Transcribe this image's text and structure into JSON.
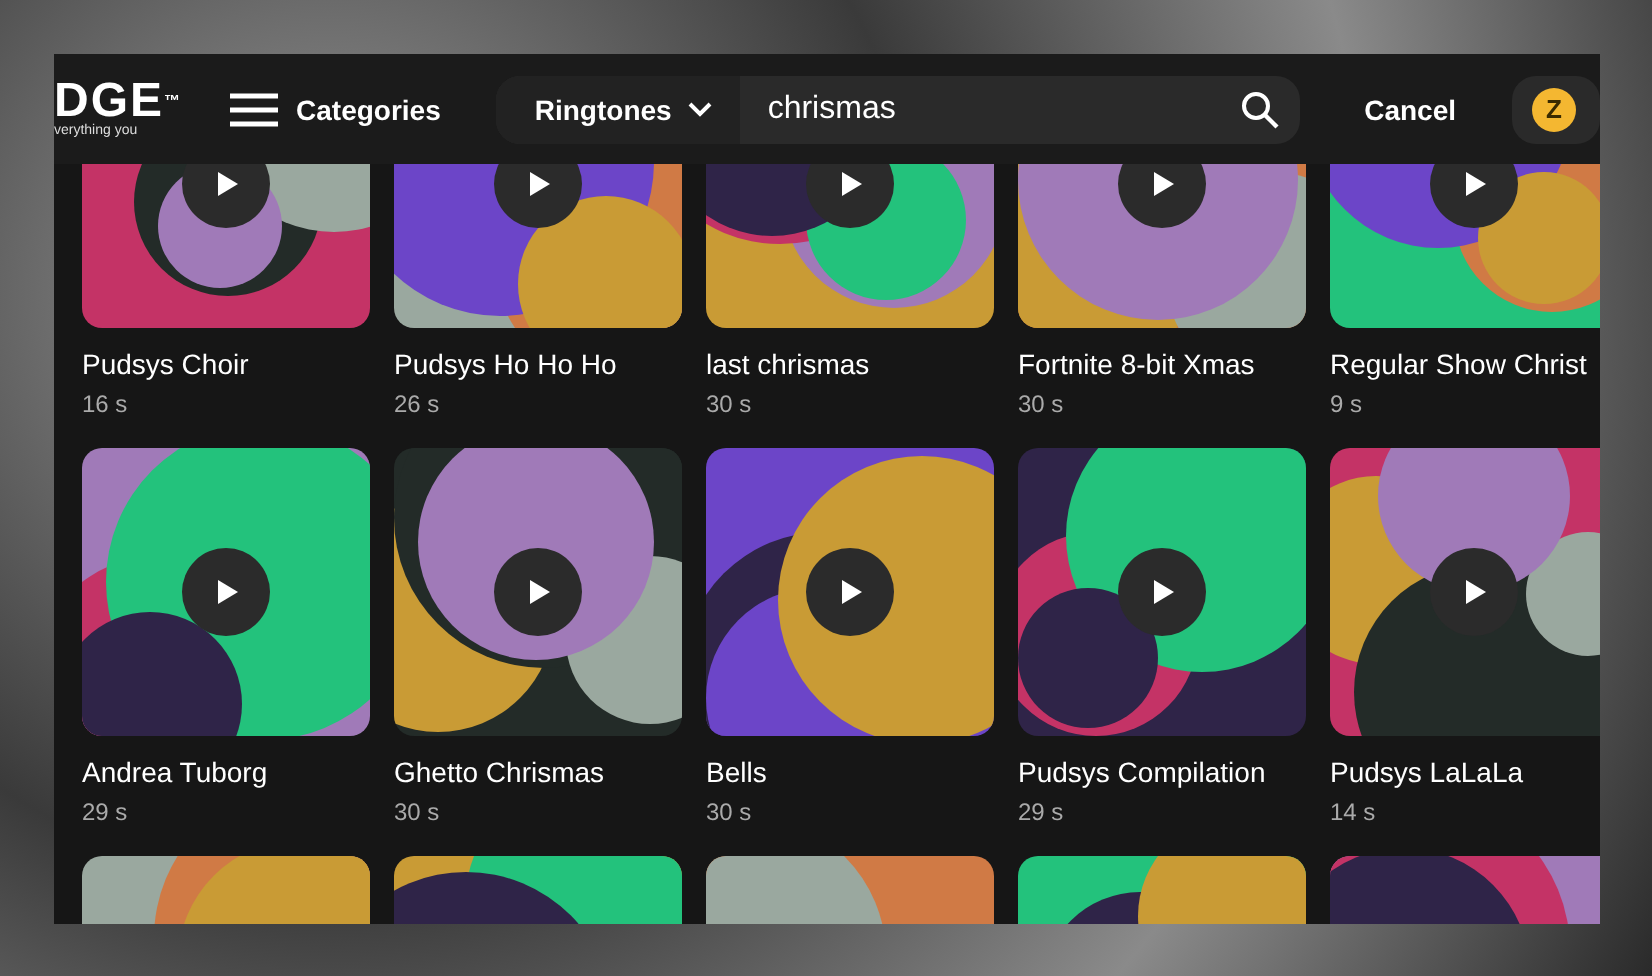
{
  "header": {
    "logo": {
      "mark": "DGE",
      "trademark": "™",
      "tagline": "verything you"
    },
    "categories": "Categories",
    "search": {
      "filter": "Ringtones",
      "value": "chrismas"
    },
    "cancel": "Cancel",
    "coin": "Z"
  },
  "ringtones": [
    {
      "kind": "ringtone",
      "title": "Pudsys Choir",
      "duration": "16 s"
    },
    {
      "kind": "ringtone",
      "title": "Pudsys Ho Ho Ho",
      "duration": "26 s"
    },
    {
      "kind": "ringtone",
      "title": "last chrismas",
      "duration": "30 s"
    },
    {
      "kind": "ringtone",
      "title": "Fortnite 8-bit Xmas",
      "duration": "30 s"
    },
    {
      "kind": "ringtone",
      "title": "Regular Show Christ",
      "duration": "9 s"
    },
    {
      "kind": "ringtone",
      "title": "Andrea Tuborg",
      "duration": "29 s"
    },
    {
      "kind": "ringtone",
      "title": "Ghetto Chrismas",
      "duration": "30 s"
    },
    {
      "kind": "ringtone",
      "title": "Bells",
      "duration": "30 s"
    },
    {
      "kind": "ringtone",
      "title": "Pudsys Compilation",
      "duration": "29 s"
    },
    {
      "kind": "ringtone",
      "title": "Pudsys LaLaLa",
      "duration": "14 s"
    },
    {
      "kind": "cover"
    },
    {
      "kind": "cover"
    },
    {
      "kind": "cover"
    },
    {
      "kind": "cover"
    },
    {
      "kind": "cover"
    }
  ]
}
